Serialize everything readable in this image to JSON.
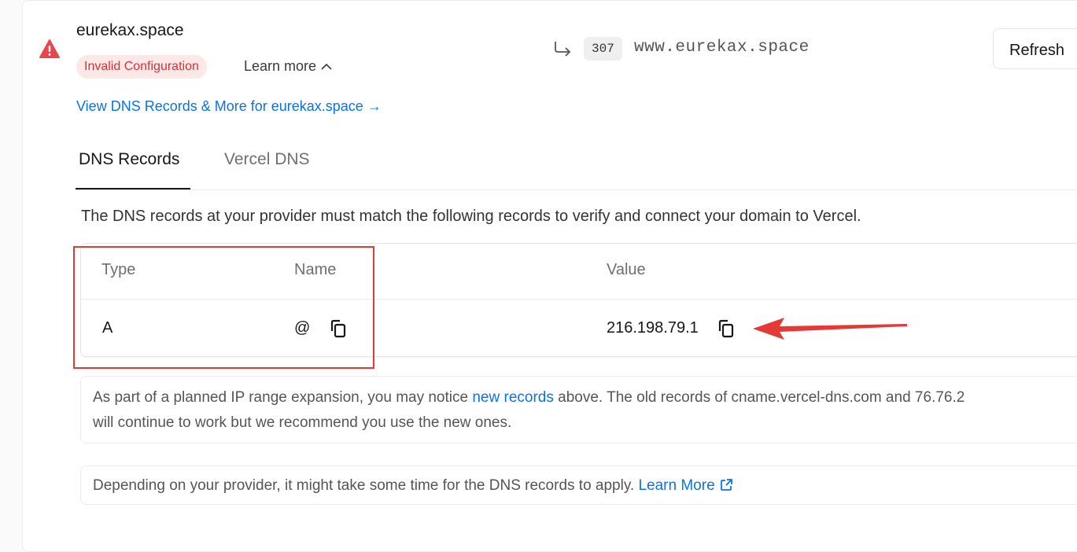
{
  "domain": {
    "name": "eurekax.space",
    "status_badge": "Invalid Configuration",
    "learn_more": "Learn more",
    "view_dns_link": "View DNS Records & More for eurekax.space →",
    "redirect_code": "307",
    "redirect_target": "www.eurekax.space",
    "refresh_label": "Refresh"
  },
  "tabs": [
    {
      "label": "DNS Records",
      "active": true
    },
    {
      "label": "Vercel DNS",
      "active": false
    }
  ],
  "description": "The DNS records at your provider must match the following records to verify and connect your domain to Vercel.",
  "records_table": {
    "headers": [
      "Type",
      "Name",
      "Value"
    ],
    "rows": [
      {
        "type": "A",
        "name": "@",
        "value": "216.198.79.1"
      }
    ]
  },
  "notes": {
    "ip_expansion_before": "As part of a planned IP range expansion, you may notice ",
    "ip_expansion_link": "new records",
    "ip_expansion_after": " above. The old records of cname.vercel-dns.com and 76.76.2",
    "ip_expansion_line2": "will continue to work but we recommend you use the new ones.",
    "propagation_text": "Depending on your provider, it might take some time for the DNS records to apply. ",
    "propagation_link": "Learn More"
  },
  "icons": {
    "warning": "warning-triangle-icon",
    "redirect": "redirect-arrow-icon",
    "copy": "copy-icon",
    "external": "external-link-icon"
  },
  "colors": {
    "link": "#0a72ef",
    "error": "#d93036",
    "error_bg": "#fde8e8",
    "annotation_red": "#e53935"
  }
}
